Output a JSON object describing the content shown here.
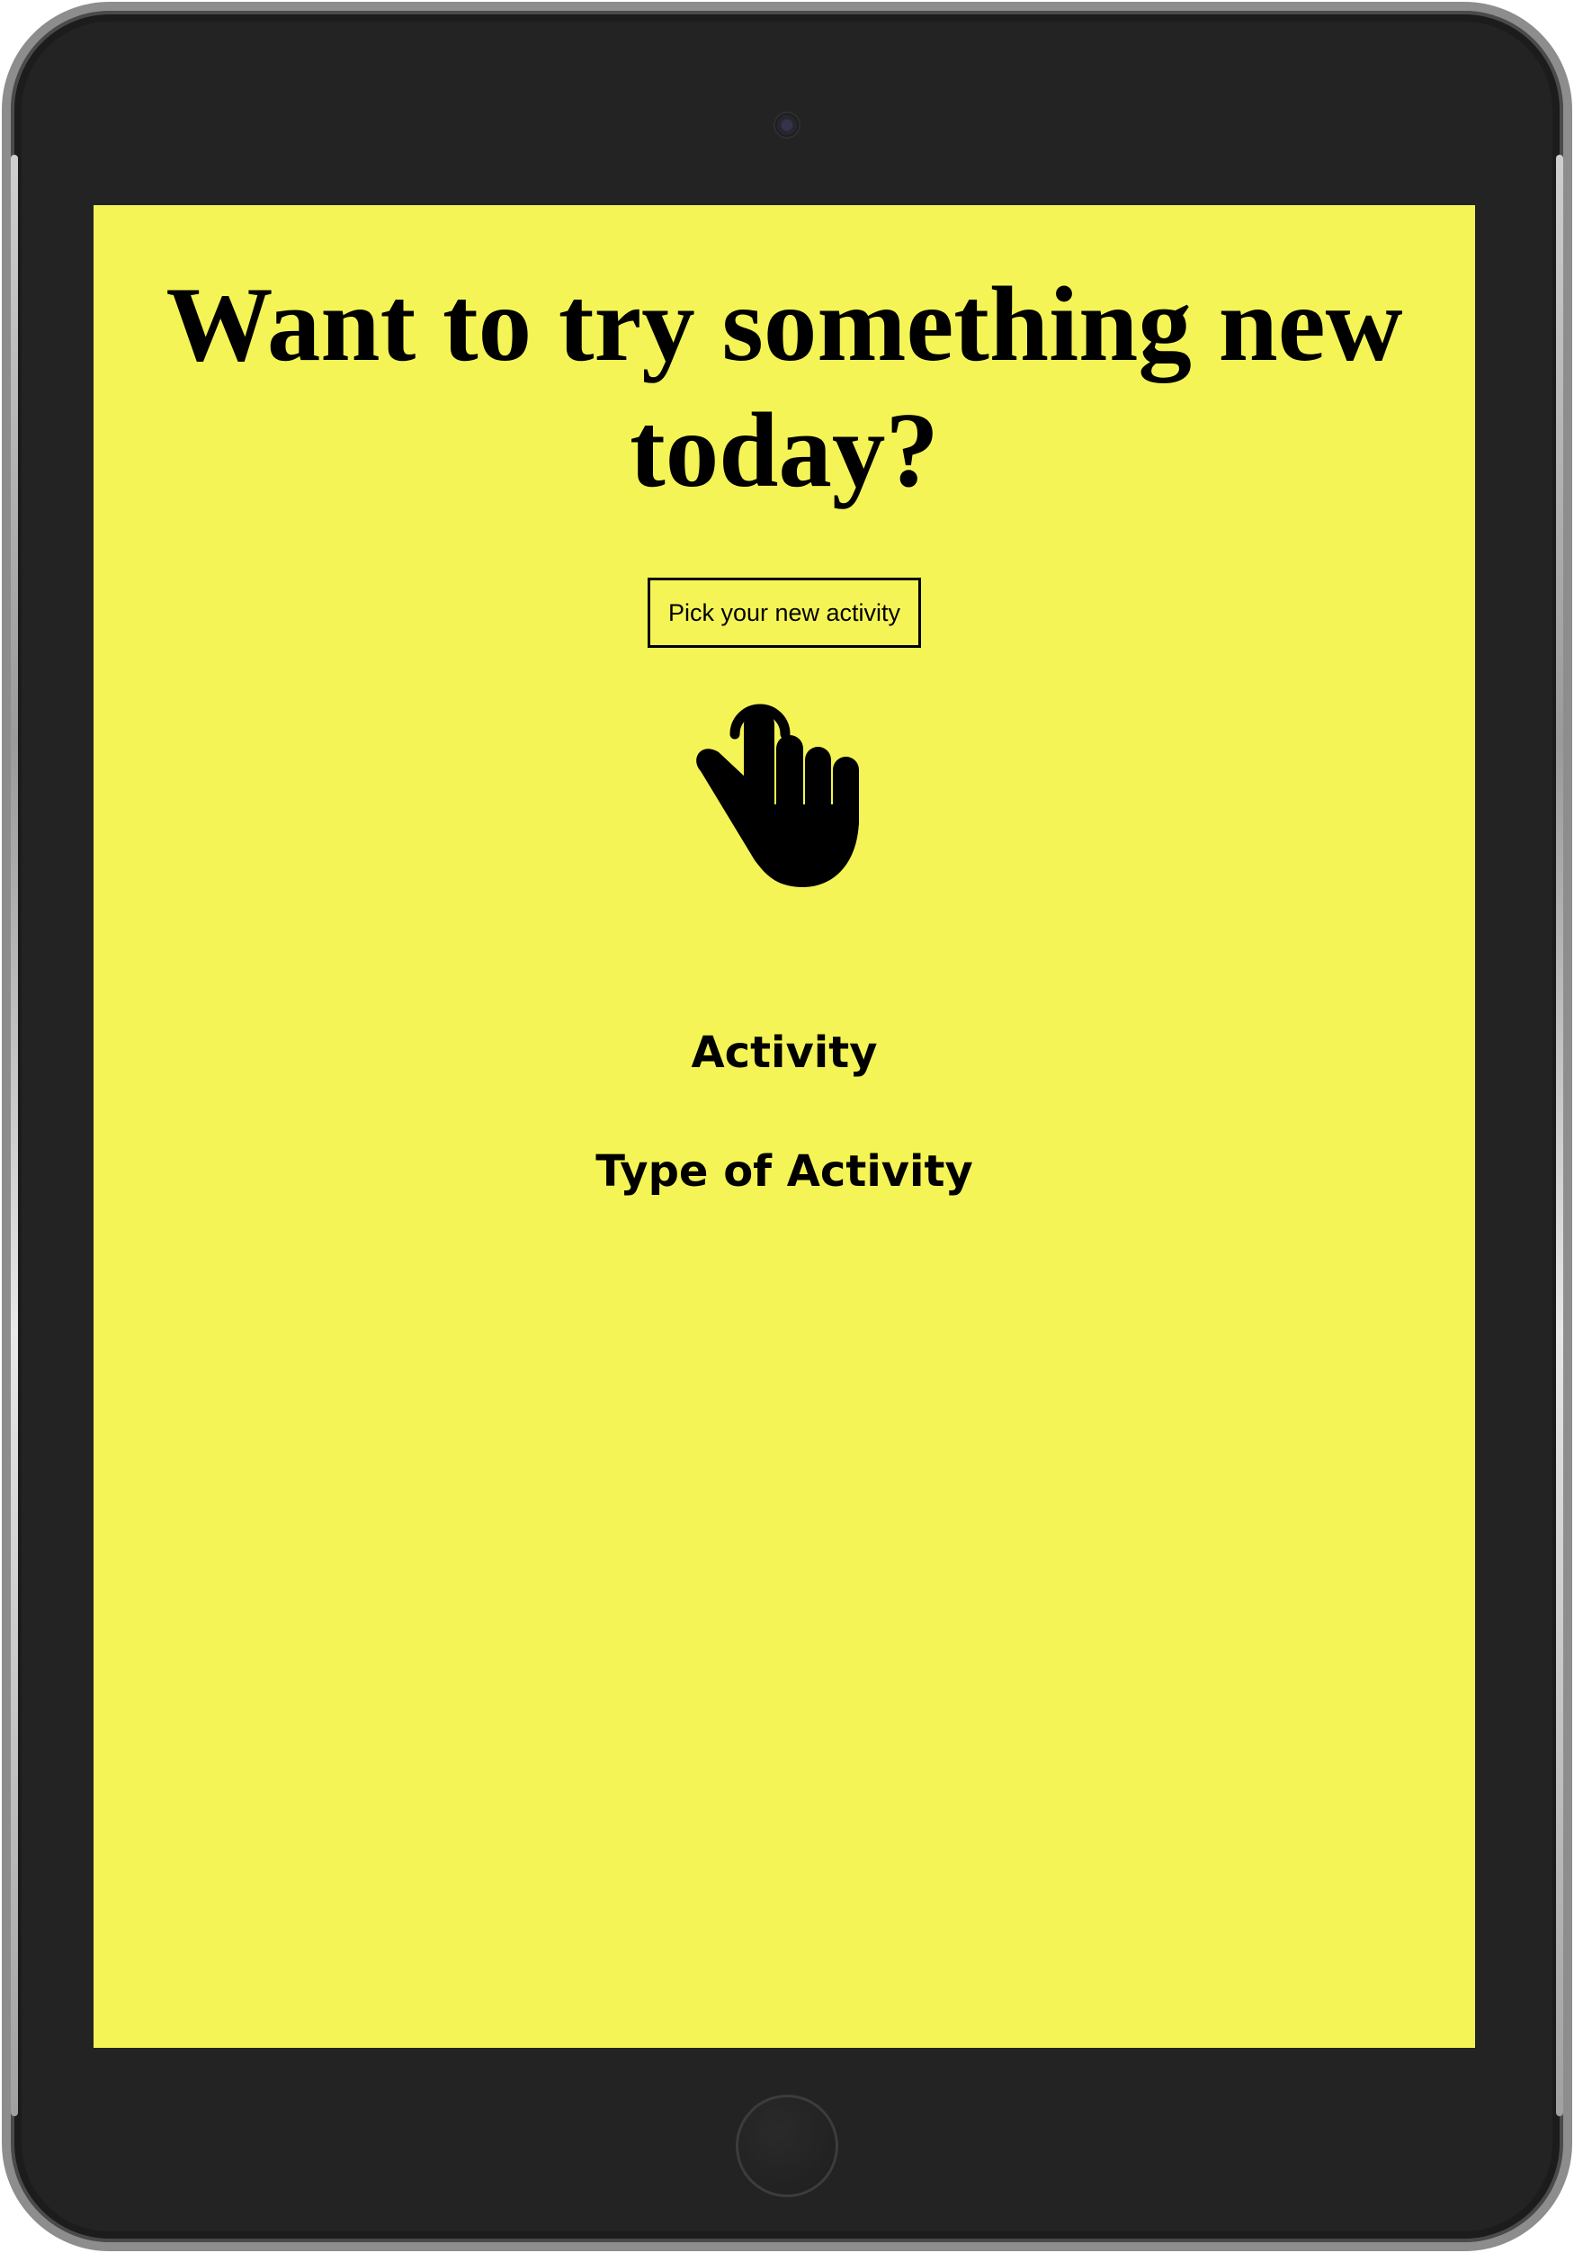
{
  "device": {
    "frame_color": "#232323",
    "screen_color": "#f4f457"
  },
  "main": {
    "headline": "Want to try something new today?",
    "pick_button_label": "Pick your new activity",
    "pointer_icon": "hand-pointer-icon",
    "activity_label": "Activity",
    "type_label": "Type of Activity"
  }
}
